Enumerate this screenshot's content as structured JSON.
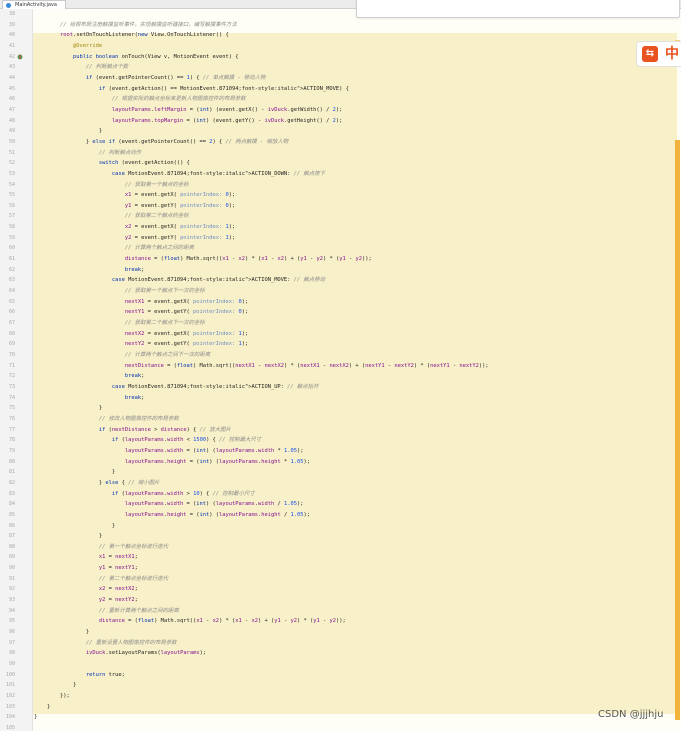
{
  "tab": {
    "file_name": "MainActivity.java"
  },
  "plugin": {
    "label": "中"
  },
  "watermark": "CSDN @jjjhju",
  "colors": {
    "comment": "#8c8c8c",
    "keyword": "#0033b3",
    "field": "#871094",
    "constant": "#871094",
    "hint": "#6c8ec4",
    "number": "#1750eb",
    "annotation": "#9e880d",
    "highlight": "#f8f0c8"
  },
  "lines": [
    {
      "n": "38",
      "code": ""
    },
    {
      "n": "39",
      "code": "        // 给根布局注册触摸监听事件，实现触摸监听器接口，编写触摸事件方法"
    },
    {
      "n": "40",
      "code": "        root.setOnTouchListener(new View.OnTouchListener() {"
    },
    {
      "n": "41",
      "code": "            @Override"
    },
    {
      "n": "42",
      "code": "            public boolean onTouch(View v, MotionEvent event) {"
    },
    {
      "n": "43",
      "code": "                // 判断触点个数"
    },
    {
      "n": "44",
      "code": "                if (event.getPointerCount() == 1) { // 单点触摸 - 移动人物"
    },
    {
      "n": "45",
      "code": "                    if (event.getAction() == MotionEvent.ACTION_MOVE) {"
    },
    {
      "n": "46",
      "code": "                        // 根据实际的触点坐标来更新人物图像控件的布局参数"
    },
    {
      "n": "47",
      "code": "                        layoutParams.leftMargin = (int) (event.getX() - ivDuck.getWidth() / 2);"
    },
    {
      "n": "48",
      "code": "                        layoutParams.topMargin = (int) (event.getY() - ivDuck.getHeight() / 2);"
    },
    {
      "n": "49",
      "code": "                    }"
    },
    {
      "n": "50",
      "code": "                } else if (event.getPointerCount() == 2) { // 两点触摸 - 缩放人物"
    },
    {
      "n": "51",
      "code": "                    // 判断触点动作"
    },
    {
      "n": "52",
      "code": "                    switch (event.getAction()) {"
    },
    {
      "n": "53",
      "code": "                        case MotionEvent.ACTION_DOWN: // 触点按下"
    },
    {
      "n": "54",
      "code": "                            // 获取第一个触点的坐标"
    },
    {
      "n": "55",
      "code": "                            x1 = event.getX( pointerIndex: 0);"
    },
    {
      "n": "56",
      "code": "                            y1 = event.getY( pointerIndex: 0);"
    },
    {
      "n": "57",
      "code": "                            // 获取第二个触点的坐标"
    },
    {
      "n": "58",
      "code": "                            x2 = event.getX( pointerIndex: 1);"
    },
    {
      "n": "59",
      "code": "                            y2 = event.getY( pointerIndex: 1);"
    },
    {
      "n": "60",
      "code": "                            // 计算两个触点之间的距离"
    },
    {
      "n": "61",
      "code": "                            distance = (float) Math.sqrt((x1 - x2) * (x1 - x2) + (y1 - y2) * (y1 - y2));"
    },
    {
      "n": "62",
      "code": "                            break;"
    },
    {
      "n": "63",
      "code": "                        case MotionEvent.ACTION_MOVE: // 触点移动"
    },
    {
      "n": "64",
      "code": "                            // 获取第一个触点下一次的坐标"
    },
    {
      "n": "65",
      "code": "                            nextX1 = event.getX( pointerIndex: 0);"
    },
    {
      "n": "66",
      "code": "                            nextY1 = event.getY( pointerIndex: 0);"
    },
    {
      "n": "67",
      "code": "                            // 获取第二个触点下一次的坐标"
    },
    {
      "n": "68",
      "code": "                            nextX2 = event.getX( pointerIndex: 1);"
    },
    {
      "n": "69",
      "code": "                            nextY2 = event.getY( pointerIndex: 1);"
    },
    {
      "n": "70",
      "code": "                            // 计算两个触点之间下一次的距离"
    },
    {
      "n": "71",
      "code": "                            nextDistance = (float) Math.sqrt((nextX1 - nextX2) * (nextX1 - nextX2) + (nextY1 - nextY2) * (nextY1 - nextY2));"
    },
    {
      "n": "72",
      "code": "                            break;"
    },
    {
      "n": "73",
      "code": "                        case MotionEvent.ACTION_UP: // 触点抬开"
    },
    {
      "n": "74",
      "code": "                            break;"
    },
    {
      "n": "75",
      "code": "                    }"
    },
    {
      "n": "76",
      "code": "                    // 修改人物图像控件的布局参数"
    },
    {
      "n": "77",
      "code": "                    if (nextDistance > distance) { // 放大图片"
    },
    {
      "n": "78",
      "code": "                        if (layoutParams.width < 1500) { // 控制最大尺寸"
    },
    {
      "n": "79",
      "code": "                            layoutParams.width = (int) (layoutParams.width * 1.05);"
    },
    {
      "n": "80",
      "code": "                            layoutParams.height = (int) (layoutParams.height * 1.05);"
    },
    {
      "n": "81",
      "code": "                        }"
    },
    {
      "n": "82",
      "code": "                    } else { // 缩小图片"
    },
    {
      "n": "83",
      "code": "                        if (layoutParams.width > 10) { // 控制最小尺寸"
    },
    {
      "n": "84",
      "code": "                            layoutParams.width = (int) (layoutParams.width / 1.05);"
    },
    {
      "n": "85",
      "code": "                            layoutParams.height = (int) (layoutParams.height / 1.05);"
    },
    {
      "n": "86",
      "code": "                        }"
    },
    {
      "n": "87",
      "code": "                    }"
    },
    {
      "n": "88",
      "code": "                    // 第一个触点坐标进行迭代"
    },
    {
      "n": "89",
      "code": "                    x1 = nextX1;"
    },
    {
      "n": "90",
      "code": "                    y1 = nextY1;"
    },
    {
      "n": "91",
      "code": "                    // 第二个触点坐标进行迭代"
    },
    {
      "n": "92",
      "code": "                    x2 = nextX2;"
    },
    {
      "n": "93",
      "code": "                    y2 = nextY2;"
    },
    {
      "n": "94",
      "code": "                    // 重新计算两个触点之间的距离"
    },
    {
      "n": "95",
      "code": "                    distance = (float) Math.sqrt((x1 - x2) * (x1 - x2) + (y1 - y2) * (y1 - y2));"
    },
    {
      "n": "96",
      "code": "                }"
    },
    {
      "n": "97",
      "code": "                // 重新设置人物图像控件的布局参数"
    },
    {
      "n": "98",
      "code": "                ivDuck.setLayoutParams(layoutParams);"
    },
    {
      "n": "99",
      "code": ""
    },
    {
      "n": "100",
      "code": "                return true;"
    },
    {
      "n": "101",
      "code": "            }"
    },
    {
      "n": "102",
      "code": "        });"
    },
    {
      "n": "103",
      "code": "    }"
    },
    {
      "n": "104",
      "code": "}"
    },
    {
      "n": "105",
      "code": ""
    }
  ]
}
